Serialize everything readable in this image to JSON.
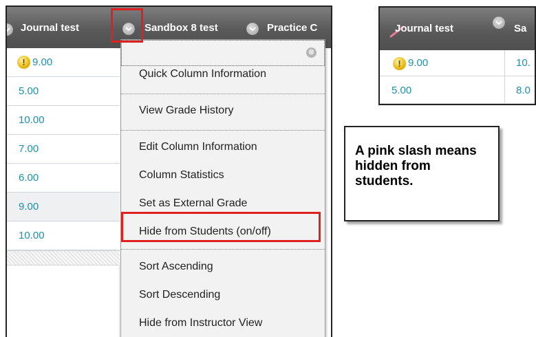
{
  "gradebook": {
    "headers": [
      "Journal test",
      "Sandbox 8 test",
      "Practice C"
    ],
    "rows": [
      {
        "value": "9.00",
        "flag": "needs-grading"
      },
      {
        "value": "5.00"
      },
      {
        "value": "10.00"
      },
      {
        "value": "7.00"
      },
      {
        "value": "6.00"
      },
      {
        "value": "9.00"
      },
      {
        "value": "10.00"
      }
    ]
  },
  "menu": {
    "close_glyph": "⊗",
    "items": [
      "Quick Column Information",
      "View Grade History",
      "Edit Column Information",
      "Column Statistics",
      "Set as External Grade",
      "Hide from Students (on/off)",
      "Sort Ascending",
      "Sort Descending",
      "Hide from Instructor View"
    ]
  },
  "preview": {
    "headers": [
      "Journal test",
      "Sa"
    ],
    "rows": [
      {
        "col1": "9.00",
        "col2": "10.",
        "flag": "needs-grading"
      },
      {
        "col1": "5.00",
        "col2": "8.0"
      }
    ]
  },
  "callout": {
    "text": "A pink slash means hidden from students."
  },
  "colors": {
    "header": "#5a5a5a",
    "grade_text": "#1e8fa8",
    "highlight": "#e01f1f",
    "hidden_slash": "#f07a9a"
  }
}
